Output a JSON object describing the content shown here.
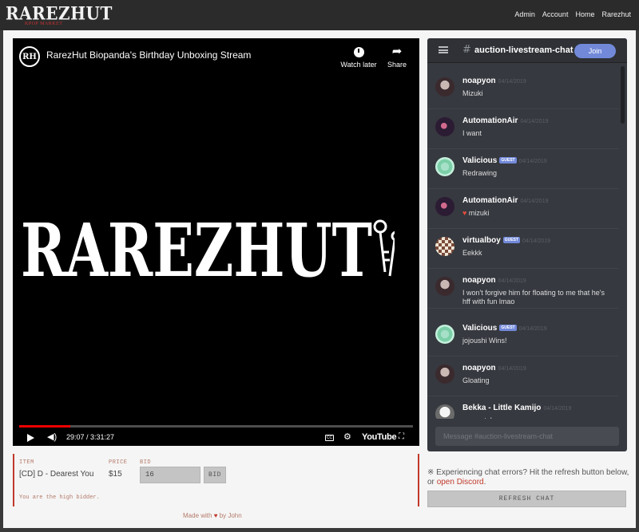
{
  "site": {
    "logo": "RAREZHUT",
    "logo_sub": "KPOP MARKET",
    "nav": [
      "Admin",
      "Account",
      "Home",
      "Rarezhut"
    ]
  },
  "video": {
    "channel_initials": "RH",
    "title": "RarezHut Biopanda's Birthday Unboxing Stream",
    "watch_later": "Watch later",
    "share": "Share",
    "big_logo_text": "RAREZHUT",
    "time": "29:07 / 3:31:27",
    "youtube": "YouTube",
    "progress_fraction": 0.13
  },
  "bid": {
    "headers": {
      "item": "ITEM",
      "price": "PRICE",
      "bid": "BID"
    },
    "item": "[CD] D - Dearest You",
    "price": "$15",
    "bid_value": "16",
    "bid_button": "BID",
    "status": "You are the high bidder."
  },
  "footer": {
    "made_with": "Made with",
    "by": "by John"
  },
  "discord": {
    "channel": "auction-livestream-chat",
    "join": "Join",
    "guest_badge": "GUEST",
    "messages": [
      {
        "author": "noapyon",
        "date": "04/14/2019",
        "text": "Mizuki",
        "avatar": "dark",
        "guest": false
      },
      {
        "author": "AutomationAir",
        "date": "04/14/2019",
        "text": "I want",
        "avatar": "purple",
        "guest": false
      },
      {
        "author": "Valicious",
        "date": "04/14/2019",
        "text": "Redrawing",
        "avatar": "green",
        "guest": true
      },
      {
        "author": "AutomationAir",
        "date": "04/14/2019",
        "text": "mizuki",
        "avatar": "purple",
        "guest": false,
        "heart": true
      },
      {
        "author": "virtualboy",
        "date": "04/14/2019",
        "text": "Eekkk",
        "avatar": "check",
        "guest": true
      },
      {
        "author": "noapyon",
        "date": "04/14/2019",
        "text": "I won't forgive him for floating to me that he's hff with fun lmao",
        "avatar": "dark",
        "guest": false
      },
      {
        "author": "Valicious",
        "date": "04/14/2019",
        "text": "jojoushi Wins!",
        "avatar": "green",
        "guest": true
      },
      {
        "author": "noapyon",
        "date": "04/14/2019",
        "text": "Gloating",
        "avatar": "dark",
        "guest": false
      },
      {
        "author": "Bekka - Little Kamijo",
        "date": "04/14/2019",
        "text": "congrats!",
        "avatar": "gray",
        "guest": false
      }
    ],
    "input_placeholder": "Message #auction-livestream-chat"
  },
  "chat_note": {
    "text": "※ Experiencing chat errors? Hit the refresh button below, or",
    "link": "open Discord",
    "end": "."
  },
  "refresh_button": "REFRESH CHAT",
  "colors": {
    "accent_red": "#c0392b",
    "discord_bg": "#36393f",
    "discord_blurple": "#7289da"
  }
}
